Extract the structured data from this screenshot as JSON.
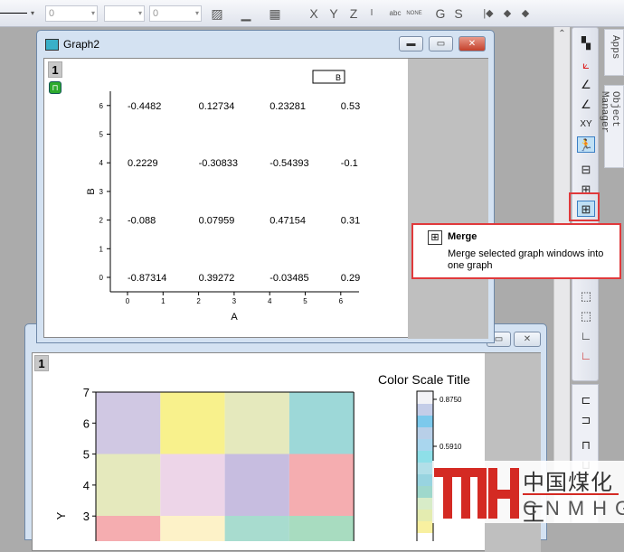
{
  "toolbar": {
    "combo1": "0",
    "combo2": "0",
    "items": [
      "X",
      "Y",
      "Z",
      "I",
      "abc",
      "NONE",
      "G",
      "S"
    ]
  },
  "graph2": {
    "title": "Graph2",
    "layer": "1",
    "legend": "B",
    "xlabel": "A",
    "ylabel": "B",
    "xticks": [
      "0",
      "1",
      "2",
      "3",
      "4",
      "5",
      "6"
    ],
    "yticks": [
      "0",
      "1",
      "2",
      "3",
      "4",
      "5",
      "6"
    ],
    "labels": [
      {
        "x": 0,
        "y": 6,
        "t": "-0.4482"
      },
      {
        "x": 2,
        "y": 6,
        "t": "0.12734"
      },
      {
        "x": 4,
        "y": 6,
        "t": "0.23281"
      },
      {
        "x": 6,
        "y": 6,
        "t": "0.53"
      },
      {
        "x": 0,
        "y": 4,
        "t": "0.2229"
      },
      {
        "x": 2,
        "y": 4,
        "t": "-0.30833"
      },
      {
        "x": 4,
        "y": 4,
        "t": "-0.54393"
      },
      {
        "x": 6,
        "y": 4,
        "t": "-0.1"
      },
      {
        "x": 0,
        "y": 2,
        "t": "-0.088"
      },
      {
        "x": 2,
        "y": 2,
        "t": "0.07959"
      },
      {
        "x": 4,
        "y": 2,
        "t": "0.47154"
      },
      {
        "x": 6,
        "y": 2,
        "t": "0.31"
      },
      {
        "x": 0,
        "y": 0,
        "t": "-0.87314"
      },
      {
        "x": 2,
        "y": 0,
        "t": "0.39272"
      },
      {
        "x": 4,
        "y": 0,
        "t": "-0.03485"
      },
      {
        "x": 6,
        "y": 0,
        "t": "0.29"
      }
    ]
  },
  "graph1": {
    "layer": "1",
    "ylabel": "Y",
    "yticks": [
      "7",
      "6",
      "5",
      "4",
      "3"
    ],
    "colorscale_title": "Color Scale Title",
    "colorscale_ticks": [
      "0.8750",
      "0.5910"
    ],
    "cells": [
      [
        "#d0c8e3",
        "#f8f18c",
        "#e5e9bd",
        "#9dd8d8"
      ],
      [
        "#e5e9bd",
        "#edd5e8",
        "#c7bde0",
        "#f5adb0"
      ],
      [
        "#f5adb0",
        "#fdf2c8",
        "#a8dccf",
        "#a8dcc0"
      ]
    ]
  },
  "tooltip": {
    "title": "Merge",
    "text": "Merge selected graph windows into one graph"
  },
  "sidetabs": {
    "apps": "Apps",
    "object_manager": "Object Manager"
  },
  "watermark": {
    "cn": "中国煤化工",
    "en": "CNMHG"
  }
}
